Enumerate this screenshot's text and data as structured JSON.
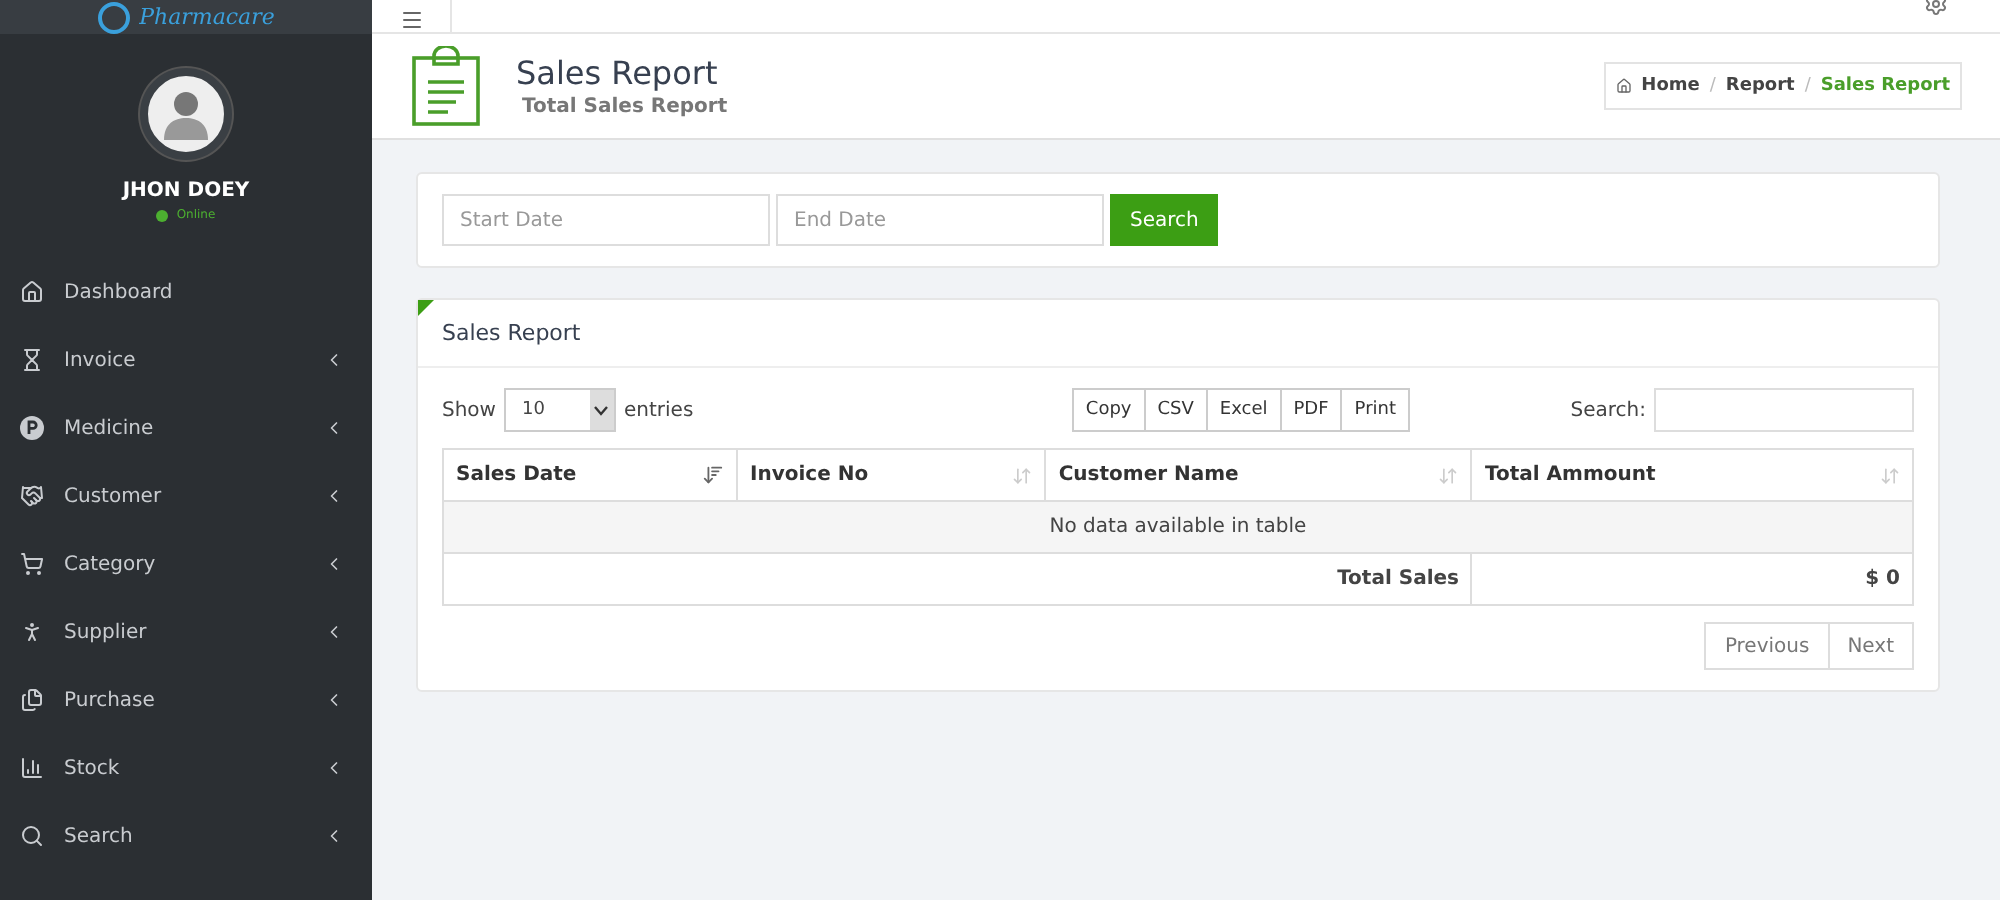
{
  "brand": {
    "name": "Pharmacare"
  },
  "user": {
    "name": "JHON DOEY",
    "status": "Online",
    "online": true
  },
  "sidebar": {
    "items": [
      {
        "label": "Dashboard",
        "has_children": false
      },
      {
        "label": "Invoice",
        "has_children": true
      },
      {
        "label": "Medicine",
        "has_children": true
      },
      {
        "label": "Customer",
        "has_children": true
      },
      {
        "label": "Category",
        "has_children": true
      },
      {
        "label": "Supplier",
        "has_children": true
      },
      {
        "label": "Purchase",
        "has_children": true
      },
      {
        "label": "Stock",
        "has_children": true
      },
      {
        "label": "Search",
        "has_children": true
      }
    ]
  },
  "page_header": {
    "title": "Sales Report",
    "subtitle": "Total Sales Report",
    "breadcrumb_separator": "/",
    "breadcrumb": [
      {
        "label": "Home",
        "active": false
      },
      {
        "label": "Report",
        "active": false
      },
      {
        "label": "Sales Report",
        "active": true
      }
    ]
  },
  "filter": {
    "start_date": {
      "placeholder": "Start Date"
    },
    "end_date": {
      "placeholder": "End Date"
    },
    "button": "Search"
  },
  "report": {
    "title": "Sales Report",
    "show_label": "Show",
    "page_size": "10",
    "entries_label": "entries",
    "export_buttons": [
      "Copy",
      "CSV",
      "Excel",
      "PDF",
      "Print"
    ],
    "search_label": "Search:",
    "columns": [
      {
        "label": "Sales Date",
        "sorted": true
      },
      {
        "label": "Invoice No",
        "sorted": false
      },
      {
        "label": "Customer Name",
        "sorted": false
      },
      {
        "label": "Total Ammount",
        "sorted": false
      }
    ],
    "empty_message": "No data available in table",
    "footer": {
      "label": "Total Sales",
      "value": "$ 0"
    },
    "pagination": [
      "Previous",
      "Next"
    ]
  }
}
